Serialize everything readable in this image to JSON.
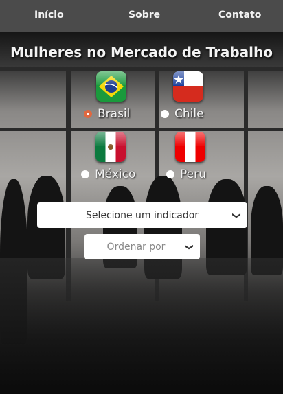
{
  "nav": {
    "items": [
      {
        "label": "Início"
      },
      {
        "label": "Sobre"
      },
      {
        "label": "Contato"
      }
    ]
  },
  "title": "Mulheres no Mercado de Trabalho",
  "countries": [
    {
      "label": "Brasil",
      "selected": true
    },
    {
      "label": "Chile",
      "selected": false
    },
    {
      "label": "México",
      "selected": false
    },
    {
      "label": "Peru",
      "selected": false
    }
  ],
  "indicator_select": {
    "value": "Selecione um indicador"
  },
  "order_select": {
    "value": "Ordenar por"
  },
  "colors": {
    "nav": "#4b4b4b",
    "radio_selected": "#e0683f"
  }
}
